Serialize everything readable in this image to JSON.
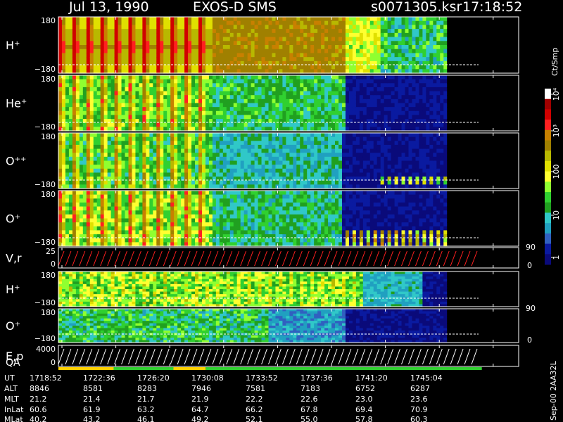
{
  "header": {
    "date": "Jul 13, 1990",
    "instrument": "EXOS-D SMS",
    "file": "s0071305.ksr",
    "time": "17:18:52"
  },
  "colorbar": {
    "unit_label": "Ct/Smp",
    "tick_labels": [
      "10⁴",
      "10³",
      "100",
      "10",
      "1"
    ],
    "colors": [
      "#ffffff",
      "#a00000",
      "#d00000",
      "#ff2020",
      "#c88000",
      "#a08000",
      "#b8b800",
      "#e0e000",
      "#ffff30",
      "#90ff30",
      "#30d030",
      "#20a020",
      "#30c8c8",
      "#20a0c0",
      "#3060c0",
      "#0a1aa0",
      "#0a0a7a"
    ]
  },
  "chart_data": {
    "type": "heatmap",
    "panels": [
      {
        "name": "H⁺",
        "kind": "spectrogram",
        "ymin_label": "−180",
        "ymax_label": "180",
        "intensity_profile": "h1"
      },
      {
        "name": "He⁺",
        "kind": "spectrogram",
        "ymin_label": "−180",
        "ymax_label": "180",
        "intensity_profile": "he"
      },
      {
        "name": "O⁺⁺",
        "kind": "spectrogram",
        "ymin_label": "−180",
        "ymax_label": "180",
        "intensity_profile": "o2"
      },
      {
        "name": "O⁺",
        "kind": "spectrogram",
        "ymin_label": "−180",
        "ymax_label": "180",
        "intensity_profile": "o1"
      },
      {
        "name": "V,r",
        "kind": "line",
        "ymin_label": "0",
        "ymax_label": "25",
        "right_labels": [
          "90",
          "0"
        ],
        "line_color": "#ff2020"
      },
      {
        "name": "H⁺",
        "kind": "spectrogram",
        "ymin_label": "−180",
        "ymax_label": "180",
        "intensity_profile": "h2"
      },
      {
        "name": "O⁺",
        "kind": "spectrogram",
        "ymin_label": "−180",
        "ymax_label": "180",
        "intensity_profile": "o3",
        "right_labels": [
          "90",
          "0"
        ]
      },
      {
        "name": "E,p",
        "kind": "line",
        "ymin_label": "0",
        "ymax_label": "4000",
        "line_color": "#ffffff",
        "sub_label": "QA"
      }
    ],
    "qa_bar": [
      {
        "from": 0.0,
        "to": 0.12,
        "color": "#ffd000"
      },
      {
        "from": 0.12,
        "to": 0.25,
        "color": "#30d030"
      },
      {
        "from": 0.25,
        "to": 0.32,
        "color": "#ffd000"
      },
      {
        "from": 0.32,
        "to": 0.92,
        "color": "#30d030"
      }
    ],
    "ephemeris": {
      "row_labels": [
        "UT",
        "ALT",
        "MLT",
        "InLat",
        "MLat"
      ],
      "columns": [
        [
          "1718:52",
          "8846",
          "21.2",
          "60.6",
          "40.2"
        ],
        [
          "1722:36",
          "8581",
          "21.4",
          "61.9",
          "43.2"
        ],
        [
          "1726:20",
          "8283",
          "21.7",
          "63.2",
          "46.1"
        ],
        [
          "1730:08",
          "7946",
          "21.9",
          "64.7",
          "49.2"
        ],
        [
          "1733:52",
          "7581",
          "22.2",
          "66.2",
          "52.1"
        ],
        [
          "1737:36",
          "7183",
          "22.6",
          "67.8",
          "55.0"
        ],
        [
          "1741:20",
          "6752",
          "23.0",
          "69.4",
          "57.8"
        ],
        [
          "1745:04",
          "6287",
          "23.6",
          "70.9",
          "60.3"
        ]
      ]
    }
  },
  "footer": {
    "stamp": "Sep-00  2AA32L"
  }
}
